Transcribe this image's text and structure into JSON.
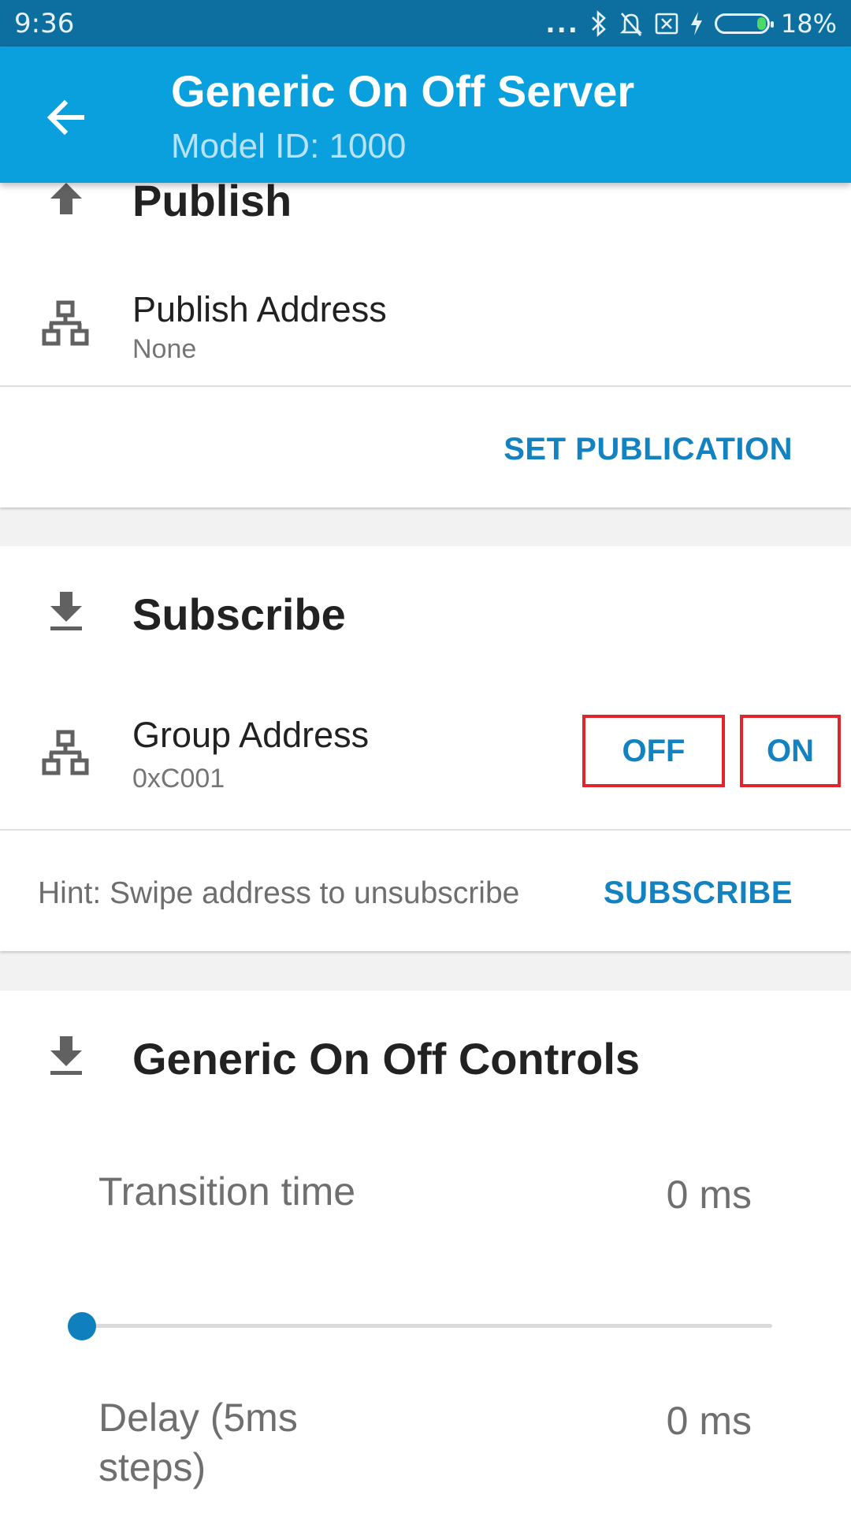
{
  "status_bar": {
    "time": "9:36",
    "more": "...",
    "battery_percent": "18%",
    "battery_level": 0.18,
    "icons": [
      "bluetooth-icon",
      "bell-muted-icon",
      "sim-off-icon",
      "charging-icon",
      "battery-icon"
    ]
  },
  "app_bar": {
    "title": "Generic On Off Server",
    "subtitle": "Model ID: 1000",
    "back_icon": "arrow-back-icon"
  },
  "publish": {
    "title": "Publish",
    "icon": "upload-icon",
    "address_title": "Publish Address",
    "address_value": "None",
    "address_icon": "network-icon",
    "action_label": "SET PUBLICATION"
  },
  "subscribe": {
    "title": "Subscribe",
    "icon": "download-icon",
    "address_title": "Group Address",
    "address_value": "0xC001",
    "address_icon": "network-icon",
    "off_label": "OFF",
    "on_label": "ON",
    "hint": "Hint: Swipe address to unsubscribe",
    "action_label": "SUBSCRIBE"
  },
  "controls": {
    "title": "Generic On Off Controls",
    "icon": "download-icon",
    "transition_label": "Transition time",
    "transition_value": "0 ms",
    "transition_slider_fraction": 0,
    "delay_label": "Delay (5ms steps)",
    "delay_value": "0 ms"
  },
  "colors": {
    "status_bar": "#0d6fa0",
    "app_bar": "#0a9fdd",
    "accent": "#1282c0",
    "highlight_border": "#e0262b"
  }
}
